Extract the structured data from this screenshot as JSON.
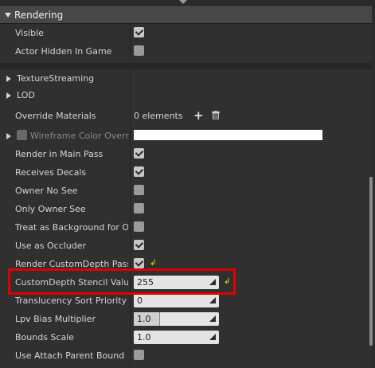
{
  "section": {
    "title": "Rendering"
  },
  "rows": {
    "visible": {
      "label": "Visible",
      "checked": true
    },
    "actor_hidden": {
      "label": "Actor Hidden In Game",
      "checked": false
    },
    "texture_streaming": {
      "label": "TextureStreaming"
    },
    "lod": {
      "label": "LOD"
    },
    "override_materials": {
      "label": "Override Materials",
      "value": "0 elements"
    },
    "wireframe": {
      "label": "Wireframe Color Override"
    },
    "render_main_pass": {
      "label": "Render in Main Pass",
      "checked": true
    },
    "receives_decals": {
      "label": "Receives Decals",
      "checked": true
    },
    "owner_no_see": {
      "label": "Owner No See",
      "checked": false
    },
    "only_owner_see": {
      "label": "Only Owner See",
      "checked": false
    },
    "treat_background": {
      "label": "Treat as Background for Occlusion",
      "checked": false
    },
    "use_occluder": {
      "label": "Use as Occluder",
      "checked": true
    },
    "render_custom_depth": {
      "label": "Render CustomDepth Pass",
      "checked": true
    },
    "custom_depth_stencil": {
      "label": "CustomDepth Stencil Value",
      "value": "255"
    },
    "translucency_sort": {
      "label": "Translucency Sort Priority",
      "value": "0"
    },
    "lpv_bias": {
      "label": "Lpv Bias Multiplier",
      "value": "1.0",
      "fill": 0.3
    },
    "bounds_scale": {
      "label": "Bounds Scale",
      "value": "1.0"
    },
    "use_attach_parent": {
      "label": "Use Attach Parent Bound",
      "checked": false
    }
  },
  "colors": {
    "highlight": "#e00000",
    "reset_arrow": "#e8e800"
  }
}
